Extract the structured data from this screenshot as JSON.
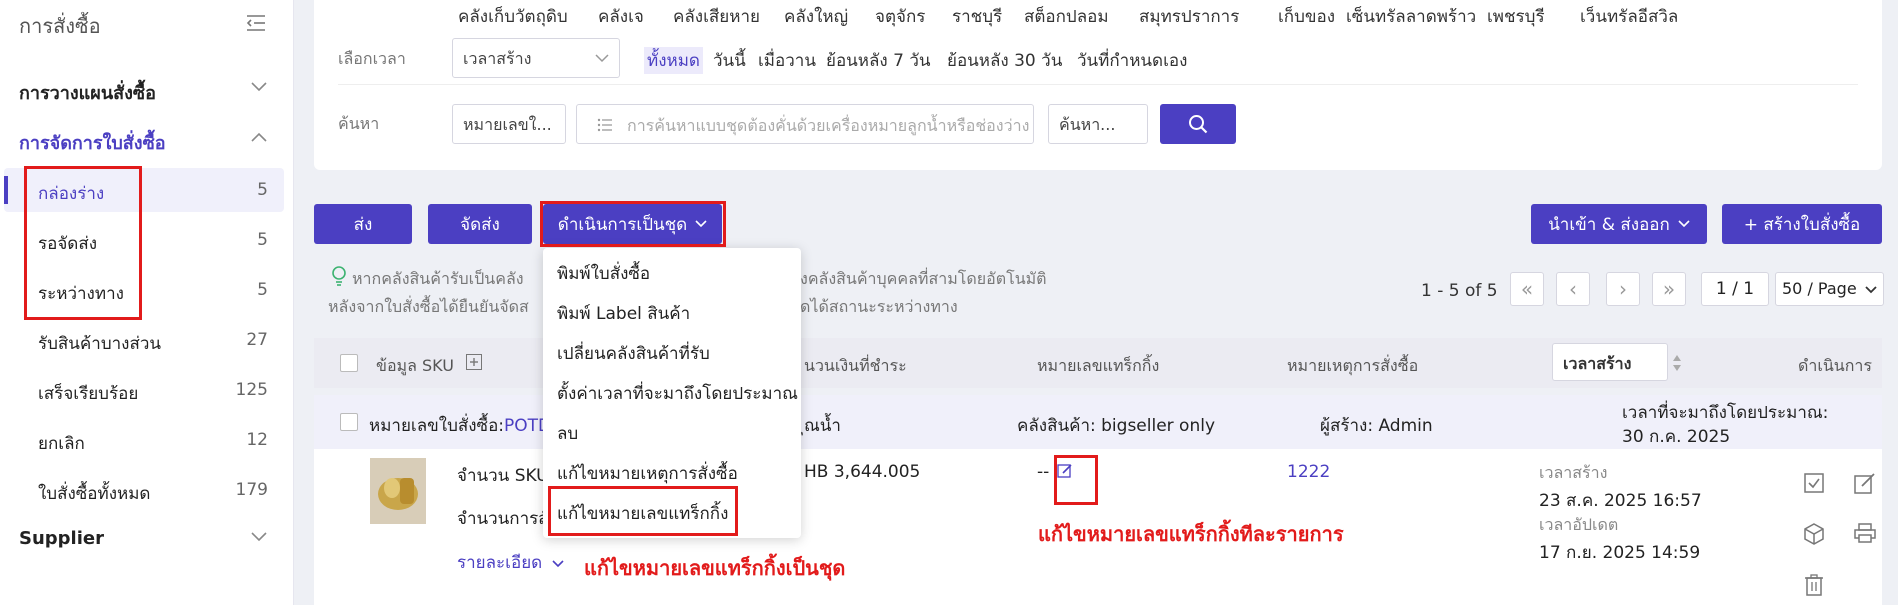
{
  "sidebar": {
    "title": "การสั่งซื้อ",
    "groups": [
      {
        "label": "การวางแผนสั่งซื้อ"
      },
      {
        "label": "การจัดการใบสั่งซื้อ"
      },
      {
        "label": "Supplier"
      }
    ],
    "items": [
      {
        "label": "กล่องร่าง",
        "count": "5"
      },
      {
        "label": "รอจัดส่ง",
        "count": "5"
      },
      {
        "label": "ระหว่างทาง",
        "count": "5"
      },
      {
        "label": "รับสินค้าบางส่วน",
        "count": "27"
      },
      {
        "label": "เสร็จเรียบร้อย",
        "count": "125"
      },
      {
        "label": "ยกเลิก",
        "count": "12"
      },
      {
        "label": "ใบสั่งซื้อทั้งหมด",
        "count": "179"
      }
    ]
  },
  "filter": {
    "warehouses": [
      "คลังเก็บวัตถุดิบ",
      "คลังเจ",
      "คลังเสียหาย",
      "คลังใหญ่",
      "จตุจักร",
      "ราชบุรี",
      "สต็อกปลอม",
      "สมุทรปราการ",
      "เก็บของ",
      "เซ็นทรัลลาดพร้าว",
      "เพชรบุรี",
      "เว็นทรัลอีสวิล"
    ],
    "time_label": "เลือกเวลา",
    "time_field": "เวลาสร้าง",
    "time_options": [
      "ทั้งหมด",
      "วันนี้",
      "เมื่อวาน",
      "ย้อนหลัง 7 วัน",
      "ย้อนหลัง 30 วัน",
      "วันที่กำหนดเอง"
    ],
    "search_label": "ค้นหา",
    "search_field": "หมายเลขใ...",
    "search_placeholder": "การค้นหาแบบชุดต้องคั่นด้วยเครื่องหมายลูกน้ำหรือช่องว่าง",
    "search_mode": "ค้นหา..."
  },
  "actions": {
    "send": "ส่ง",
    "ship": "จัดส่ง",
    "batch": "ดำเนินการเป็นชุด",
    "import_export": "นำเข้า & ส่งออก",
    "create": "+ สร้างใบสั่งซื้อ"
  },
  "note": {
    "line1a": "หากคลังสินค้ารับเป็นคลัง",
    "line1b": "งคลังสินค้าบุคคลที่สามโดยอัตโนมัติ",
    "line2a": "หลังจากใบสั่งซื้อได้ยืนยันจัดส",
    "line2b": "ดได้สถานะระหว่างทาง"
  },
  "pagination": {
    "range": "1 - 5 of 5",
    "page": "1 / 1",
    "page_size": "50 / Page"
  },
  "table": {
    "headers": {
      "sku": "ข้อมูล SKU",
      "amount": "นวนเงินที่ชำระ",
      "tracking": "หมายเลขแทร็กกิ้ง",
      "remark": "หมายเหตุการสั่งซื้อ",
      "sort": "เวลาสร้าง",
      "action": "ดำเนินการ"
    },
    "order": {
      "number_label": "หมายเลขใบสั่งซื้อ:",
      "number_value": "POTD",
      "amount_suffix": "ุณน้ำ",
      "warehouse": "คลังสินค้า: bigseller only",
      "creator": "ผู้สร้าง: Admin",
      "eta_label": "เวลาที่จะมาถึงโดยประมาณ:",
      "eta_value": "30 ก.ค. 2025"
    },
    "detail": {
      "sku_count": "จำนวน SKU",
      "qty": "จำนวนการสั่",
      "more": "รายละเอียด",
      "amount": "HB 3,644.005",
      "tracking": "--",
      "remark": "1222",
      "created_label": "เวลาสร้าง",
      "created_value": "23 ส.ค. 2025 16:57",
      "updated_label": "เวลาอัปเดต",
      "updated_value": "17 ก.ย. 2025 14:59"
    }
  },
  "batch_menu": [
    "พิมพ์ใบสั่งซื้อ",
    "พิมพ์ Label สินค้า",
    "เปลี่ยนคลังสินค้าที่รับ",
    "ตั้งค่าเวลาที่จะมาถึงโดยประมาณ",
    "ลบ",
    "แก้ไขหมายเหตุการสั่งซื้อ",
    "แก้ไขหมายเลขแทร็กกิ้ง"
  ],
  "annotations": {
    "per_item": "แก้ไขหมายเลขแทร็กกิ้งทีละรายการ",
    "batch": "แก้ไขหมายเลขแทร็กกิ้งเป็นชุด"
  },
  "colors": {
    "accent": "#4b3fc2",
    "annotation": "#e21b1b"
  }
}
